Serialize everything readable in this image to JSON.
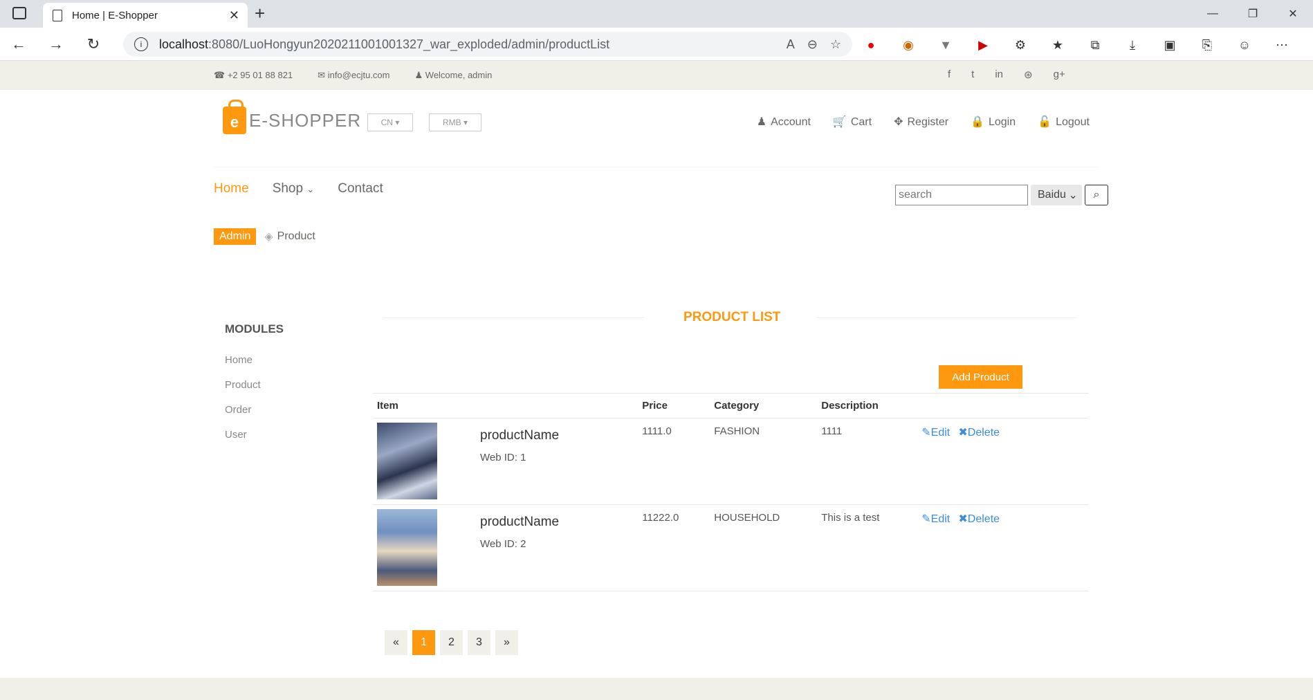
{
  "browser": {
    "tab_title": "Home | E-Shopper",
    "url_host": "localhost",
    "url_path": ":8080/LuoHongyun2020211001001327_war_exploded/admin/productList"
  },
  "topbar": {
    "phone": "+2 95 01 88 821",
    "email": "info@ecjtu.com",
    "welcome": "Welcome, admin"
  },
  "header": {
    "brand": "E-SHOPPER",
    "lang": "CN",
    "currency": "RMB",
    "account": "Account",
    "cart": "Cart",
    "register": "Register",
    "login": "Login",
    "logout": "Logout"
  },
  "nav": {
    "home": "Home",
    "shop": "Shop",
    "contact": "Contact",
    "search_placeholder": "search",
    "engine": "Baidu"
  },
  "breadcrumb": {
    "root": "Admin",
    "current": "Product"
  },
  "sidebar": {
    "title": "MODULES",
    "items": [
      "Home",
      "Product",
      "Order",
      "User"
    ]
  },
  "main": {
    "title": "PRODUCT LIST",
    "add_button": "Add Product",
    "columns": [
      "Item",
      "Price",
      "Category",
      "Description"
    ],
    "edit_label": "Edit",
    "delete_label": "Delete",
    "rows": [
      {
        "name": "productName",
        "webid": "Web ID: 1",
        "price": "1111.0",
        "category": "FASHION",
        "description": "1111"
      },
      {
        "name": "productName",
        "webid": "Web ID: 2",
        "price": "11222.0",
        "category": "HOUSEHOLD",
        "description": "This is a test"
      }
    ]
  },
  "pager": {
    "prev": "«",
    "pages": [
      "1",
      "2",
      "3"
    ],
    "next": "»"
  },
  "colors": {
    "accent": "#fe980f",
    "link": "#3a8dde"
  }
}
